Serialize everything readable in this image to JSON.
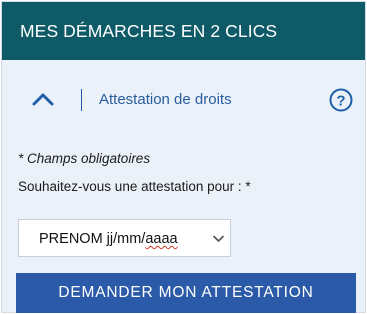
{
  "header": {
    "title": "MES DÉMARCHES EN 2 CLICS"
  },
  "accordion": {
    "title": "Attestation de droits",
    "expanded": true,
    "toggle_icon": "chevron-up-icon",
    "help_icon": "help-circle-icon",
    "help_glyph": "?"
  },
  "form": {
    "required_note": "* Champs obligatoires",
    "question_label": "Souhaitez-vous une attestation pour : *",
    "select": {
      "value_main": "PRENOM jj/mm/",
      "value_underlined": "aaaa",
      "arrow_icon": "chevron-down-icon"
    },
    "submit_label": "DEMANDER MON ATTESTATION"
  },
  "colors": {
    "header_bg": "#0e5b67",
    "panel_bg": "#ebf1f8",
    "accent_blue": "#2b5ba8",
    "link_blue": "#2a5d9e"
  }
}
